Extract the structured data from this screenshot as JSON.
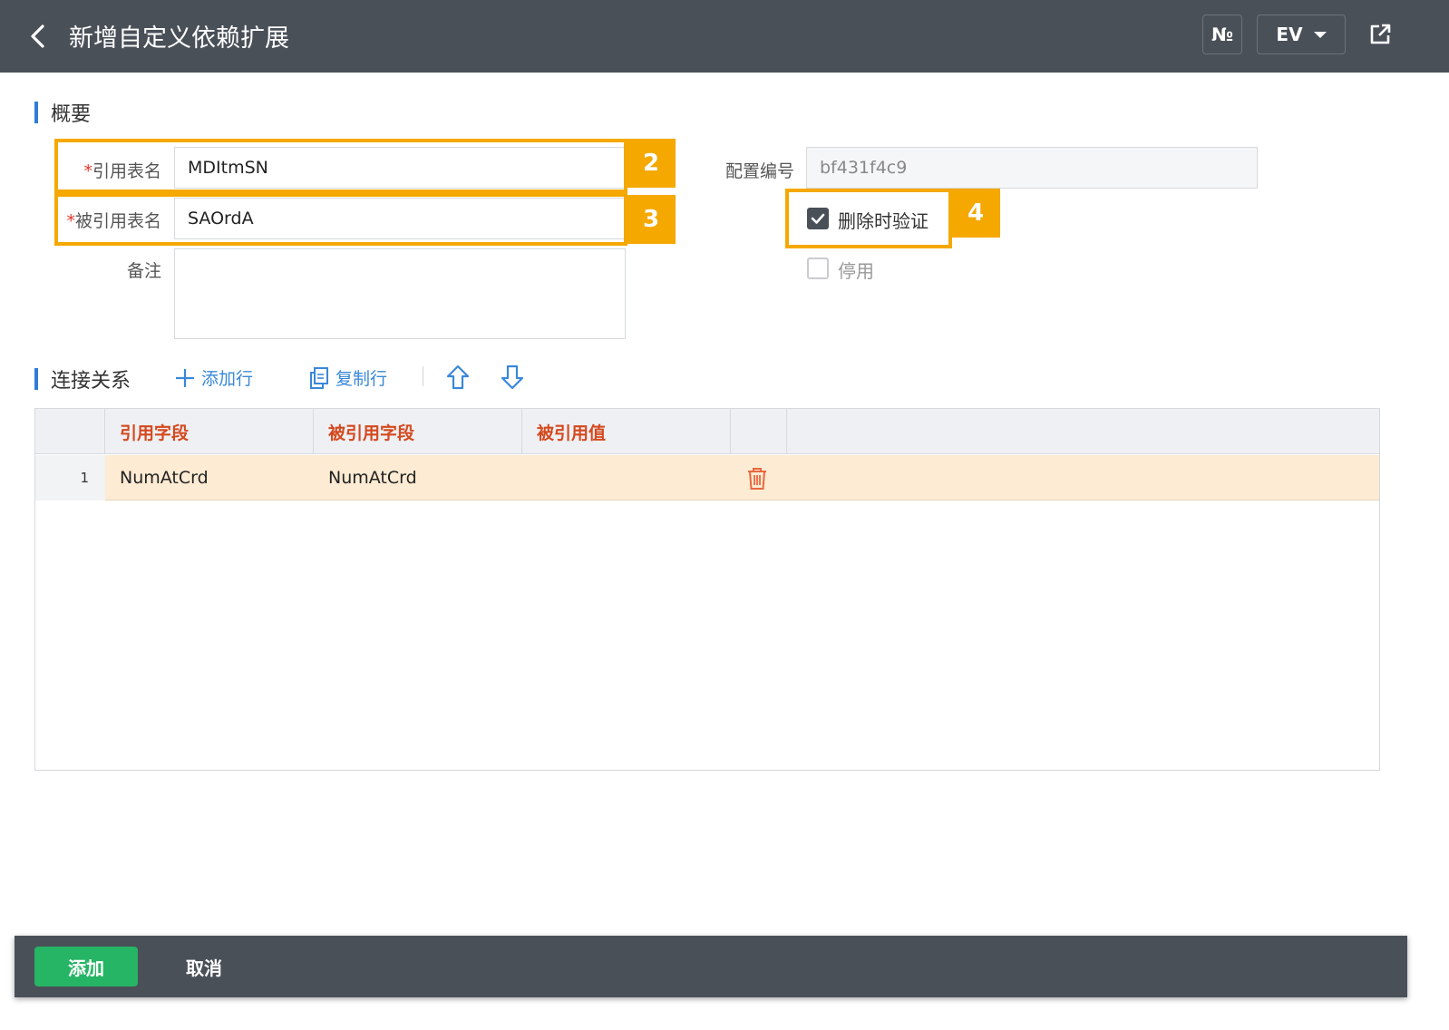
{
  "header": {
    "title": "新增自定义依赖扩展",
    "no_label": "№",
    "env_label": "EV"
  },
  "summary": {
    "section_title": "概要",
    "required_mark": "*",
    "ref_table_label": "引用表名",
    "ref_table_value": "MDItmSN",
    "referenced_table_label": "被引用表名",
    "referenced_table_value": "SAOrdA",
    "remark_label": "备注",
    "remark_value": "",
    "config_no_label": "配置编号",
    "config_no_value": "bf431f4c9",
    "validate_on_delete_label": "删除时验证",
    "validate_on_delete_checked": true,
    "disabled_label": "停用",
    "disabled_checked": false
  },
  "callouts": [
    "2",
    "3",
    "4"
  ],
  "relations": {
    "section_title": "连接关系",
    "add_row_label": "添加行",
    "copy_row_label": "复制行",
    "columns": [
      "引用字段",
      "被引用字段",
      "被引用值"
    ],
    "rows": [
      {
        "num": "1",
        "ref_field": "NumAtCrd",
        "referenced_field": "NumAtCrd",
        "referenced_value": ""
      }
    ]
  },
  "footer": {
    "add_label": "添加",
    "cancel_label": "取消"
  },
  "colors": {
    "header_bg": "#4a5058",
    "accent_blue": "#2f7dd6",
    "callout_orange": "#f5a800",
    "column_header_text": "#d4491f",
    "selected_row_bg": "#fdebd3",
    "add_button_green": "#26b565"
  }
}
